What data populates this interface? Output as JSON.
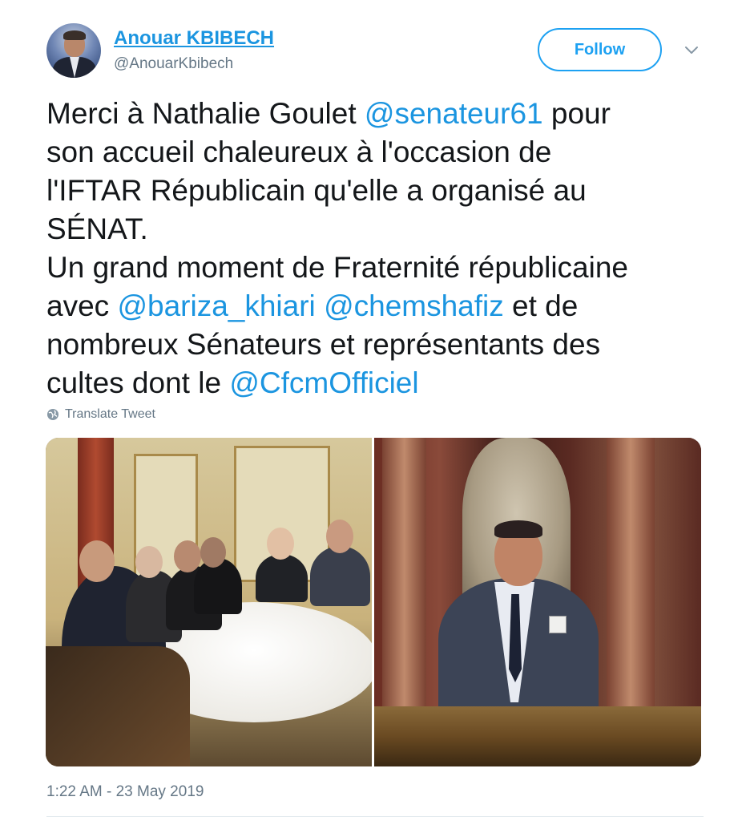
{
  "author": {
    "name": "Anouar KBIBECH",
    "handle": "@AnouarKbibech"
  },
  "follow_label": "Follow",
  "tweet": {
    "lines": [
      [
        {
          "t": "Merci à Nathalie Goulet ",
          "m": false
        },
        {
          "t": "@senateur61",
          "m": true
        },
        {
          "t": " pour",
          "m": false
        }
      ],
      [
        {
          "t": "son accueil chaleureux à l'occasion de",
          "m": false
        }
      ],
      [
        {
          "t": "l'IFTAR Républicain qu'elle a organisé au",
          "m": false
        }
      ],
      [
        {
          "t": "SÉNAT.",
          "m": false
        }
      ],
      [
        {
          "t": "Un grand moment de Fraternité républicaine",
          "m": false
        }
      ],
      [
        {
          "t": "avec ",
          "m": false
        },
        {
          "t": "@bariza_khiari",
          "m": true
        },
        {
          "t": " ",
          "m": false
        },
        {
          "t": "@chemshafiz",
          "m": true
        },
        {
          "t": " et de",
          "m": false
        }
      ],
      [
        {
          "t": "nombreux Sénateurs et représentants des",
          "m": false
        }
      ],
      [
        {
          "t": "cultes dont le ",
          "m": false
        },
        {
          "t": "@CfcmOfficiel",
          "m": true
        }
      ]
    ]
  },
  "translate_label": "Translate Tweet",
  "timestamp": "1:22 AM - 23 May 2019",
  "colors": {
    "link": "#1b95e0",
    "follow_border": "#1da1f2",
    "secondary_text": "#657786"
  },
  "icons": {
    "more": "chevron-down-icon",
    "translate": "globe-icon"
  }
}
